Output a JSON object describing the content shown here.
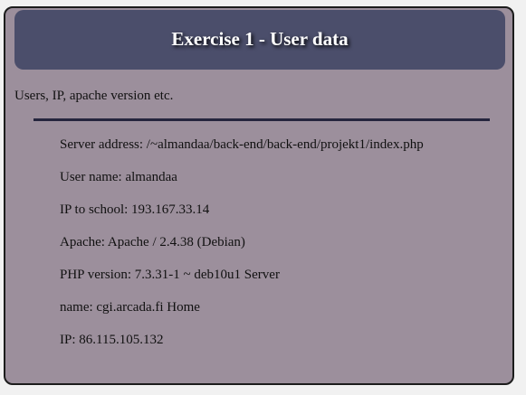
{
  "header": {
    "title": "Exercise 1 - User data"
  },
  "subtitle": "Users, IP, apache version etc.",
  "info": [
    "Server address: /~almandaa/back-end/back-end/projekt1/index.php",
    "User name: almandaa",
    "IP to school: 193.167.33.14",
    "Apache: Apache / 2.4.38 (Debian)",
    "PHP version: 7.3.31-1 ~ deb10u1 Server",
    "name: cgi.arcada.fi Home",
    "IP: 86.115.105.132"
  ],
  "colors": {
    "page_background": "#f1f1f1",
    "panel_background": "#9c8f9c",
    "header_background": "#4b4e6b",
    "divider": "#25253e",
    "title_text": "#ffffff"
  }
}
